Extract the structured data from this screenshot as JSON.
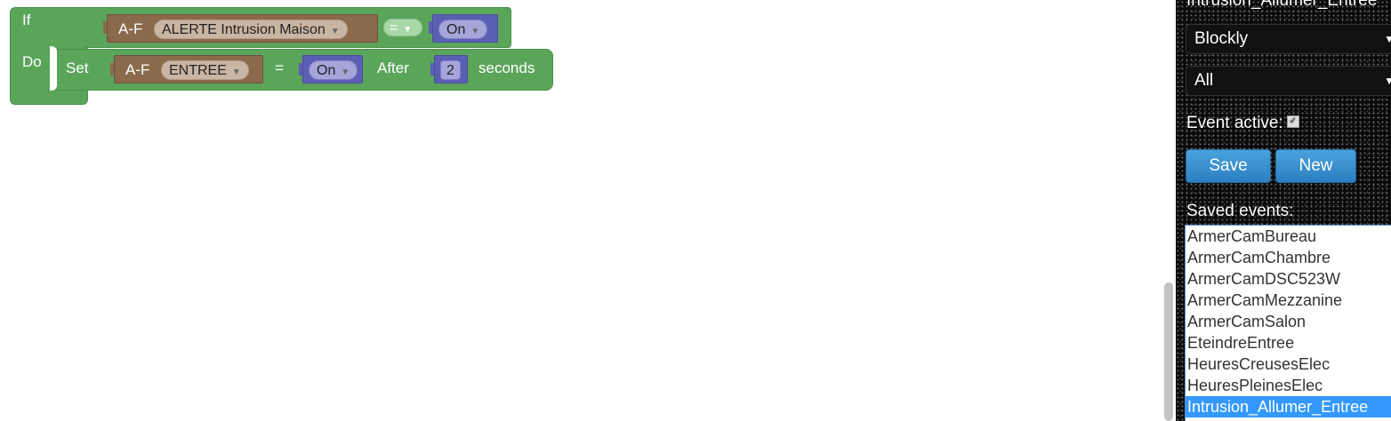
{
  "blockly": {
    "if_label": "If",
    "do_label": "Do",
    "condition": {
      "device_prefix": "A-F",
      "device_name": "ALERTE Intrusion Maison",
      "operator": "=",
      "value": "On"
    },
    "action": {
      "set_label": "Set",
      "device_prefix": "A-F",
      "device_name": "ENTREE",
      "equals": "=",
      "value": "On",
      "after_label": "After",
      "delay": "2",
      "unit_label": "seconds"
    },
    "block_color": "#5ba55b",
    "device_color": "#8b6a4c",
    "value_color": "#5b5fb3"
  },
  "panel": {
    "event_name": "Intrusion_Allumer_Entree",
    "type_select": "Blockly",
    "scope_select": "All",
    "event_active_label": "Event active:",
    "event_active_checked": true,
    "save_label": "Save",
    "new_label": "New",
    "saved_events_label": "Saved events:",
    "saved_events": [
      "ArmerCamBureau",
      "ArmerCamChambre",
      "ArmerCamDSC523W",
      "ArmerCamMezzanine",
      "ArmerCamSalon",
      "EteindreEntree",
      "HeuresCreusesElec",
      "HeuresPleinesElec",
      "Intrusion_Allumer_Entree"
    ],
    "selected_event": "Intrusion_Allumer_Entree",
    "accent_color": "#3399ff"
  }
}
